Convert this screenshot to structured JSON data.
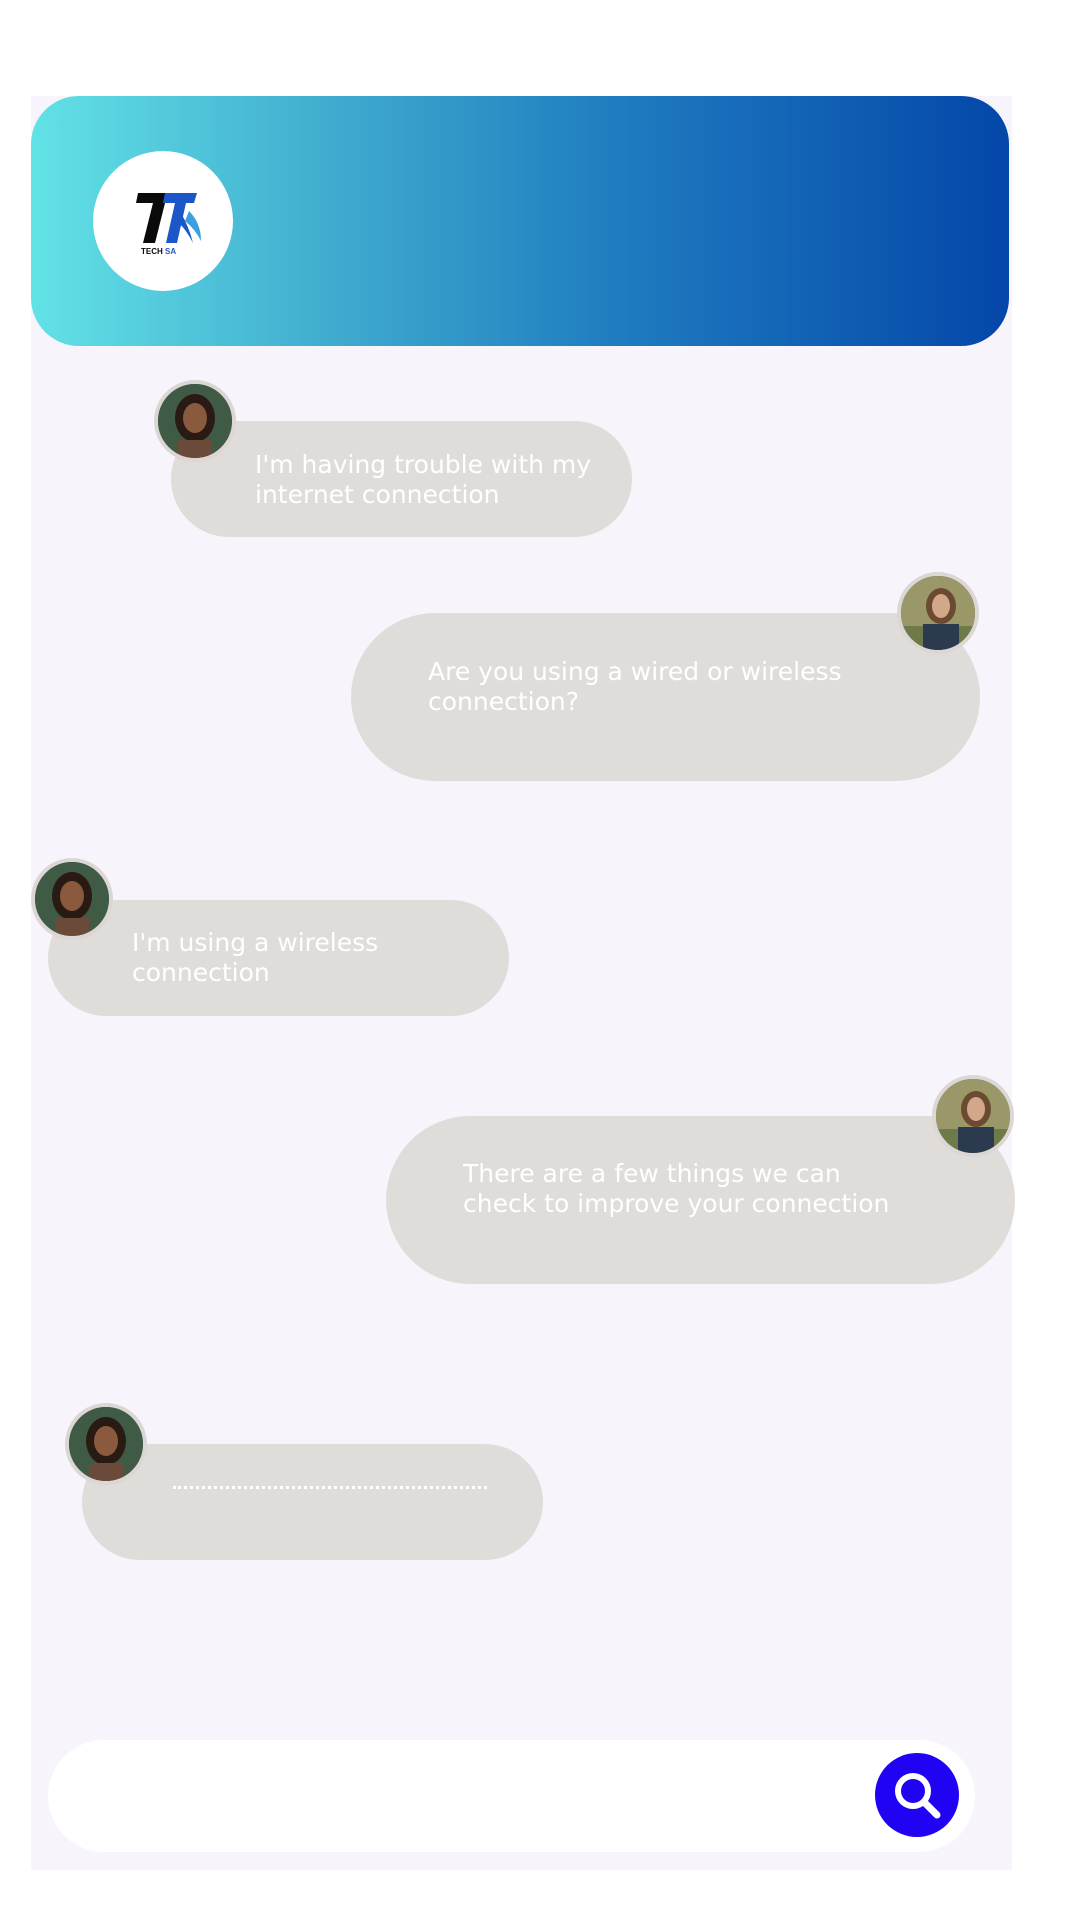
{
  "brand": {
    "logo_mark": "TT",
    "logo_text": "TECH SA",
    "header_gradient": [
      "#62e2e6",
      "#0447a9"
    ]
  },
  "conversation": [
    {
      "sender": "customer",
      "text": "I'm having trouble with my\ninternet connection"
    },
    {
      "sender": "agent",
      "text": "Are you using a wired or wireless\nconnection?"
    },
    {
      "sender": "customer",
      "text": "I'm using a wireless\nconnection"
    },
    {
      "sender": "agent",
      "text": "There are a few things we can\ncheck to improve your connection"
    },
    {
      "sender": "customer",
      "typing": true,
      "text": ""
    }
  ],
  "composer": {
    "search_icon": "search-icon",
    "button_color": "#2103f4"
  },
  "colors": {
    "bubble": "#e0dcda",
    "panel_background": "#f7f5fb"
  }
}
